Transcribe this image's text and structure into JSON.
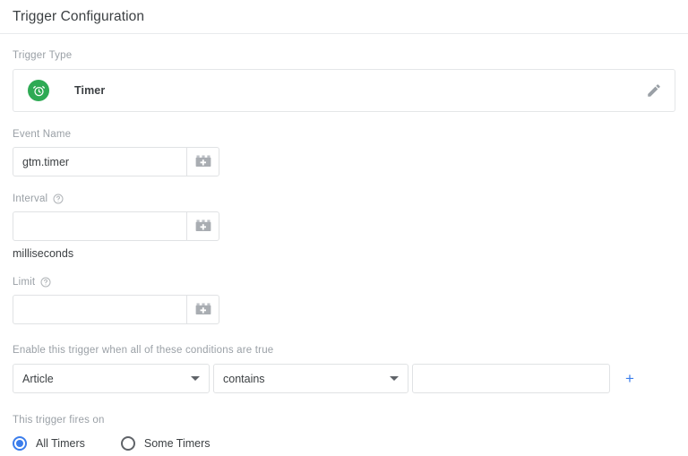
{
  "header": {
    "title": "Trigger Configuration"
  },
  "trigger_type": {
    "label": "Trigger Type",
    "name": "Timer",
    "icon": "alarm-clock-icon",
    "icon_bg": "#2eaa54",
    "edit_icon": "pencil-icon"
  },
  "event_name": {
    "label": "Event Name",
    "value": "gtm.timer",
    "placeholder": "",
    "variable_icon": "variable-block-icon"
  },
  "interval": {
    "label": "Interval",
    "help_icon": "help-circle-icon",
    "value": "",
    "placeholder": "",
    "unit": "milliseconds",
    "variable_icon": "variable-block-icon"
  },
  "limit": {
    "label": "Limit",
    "help_icon": "help-circle-icon",
    "value": "",
    "placeholder": "",
    "variable_icon": "variable-block-icon"
  },
  "conditions": {
    "label": "Enable this trigger when all of these conditions are true",
    "variable_select": "Article",
    "operator_select": "contains",
    "value": "",
    "value_placeholder": "",
    "add_label": "+",
    "add_color": "#3b7deb"
  },
  "fires_on": {
    "label": "This trigger fires on",
    "options": [
      {
        "label": "All Timers",
        "selected": true
      },
      {
        "label": "Some Timers",
        "selected": false
      }
    ],
    "accent_color": "#3b7deb"
  }
}
